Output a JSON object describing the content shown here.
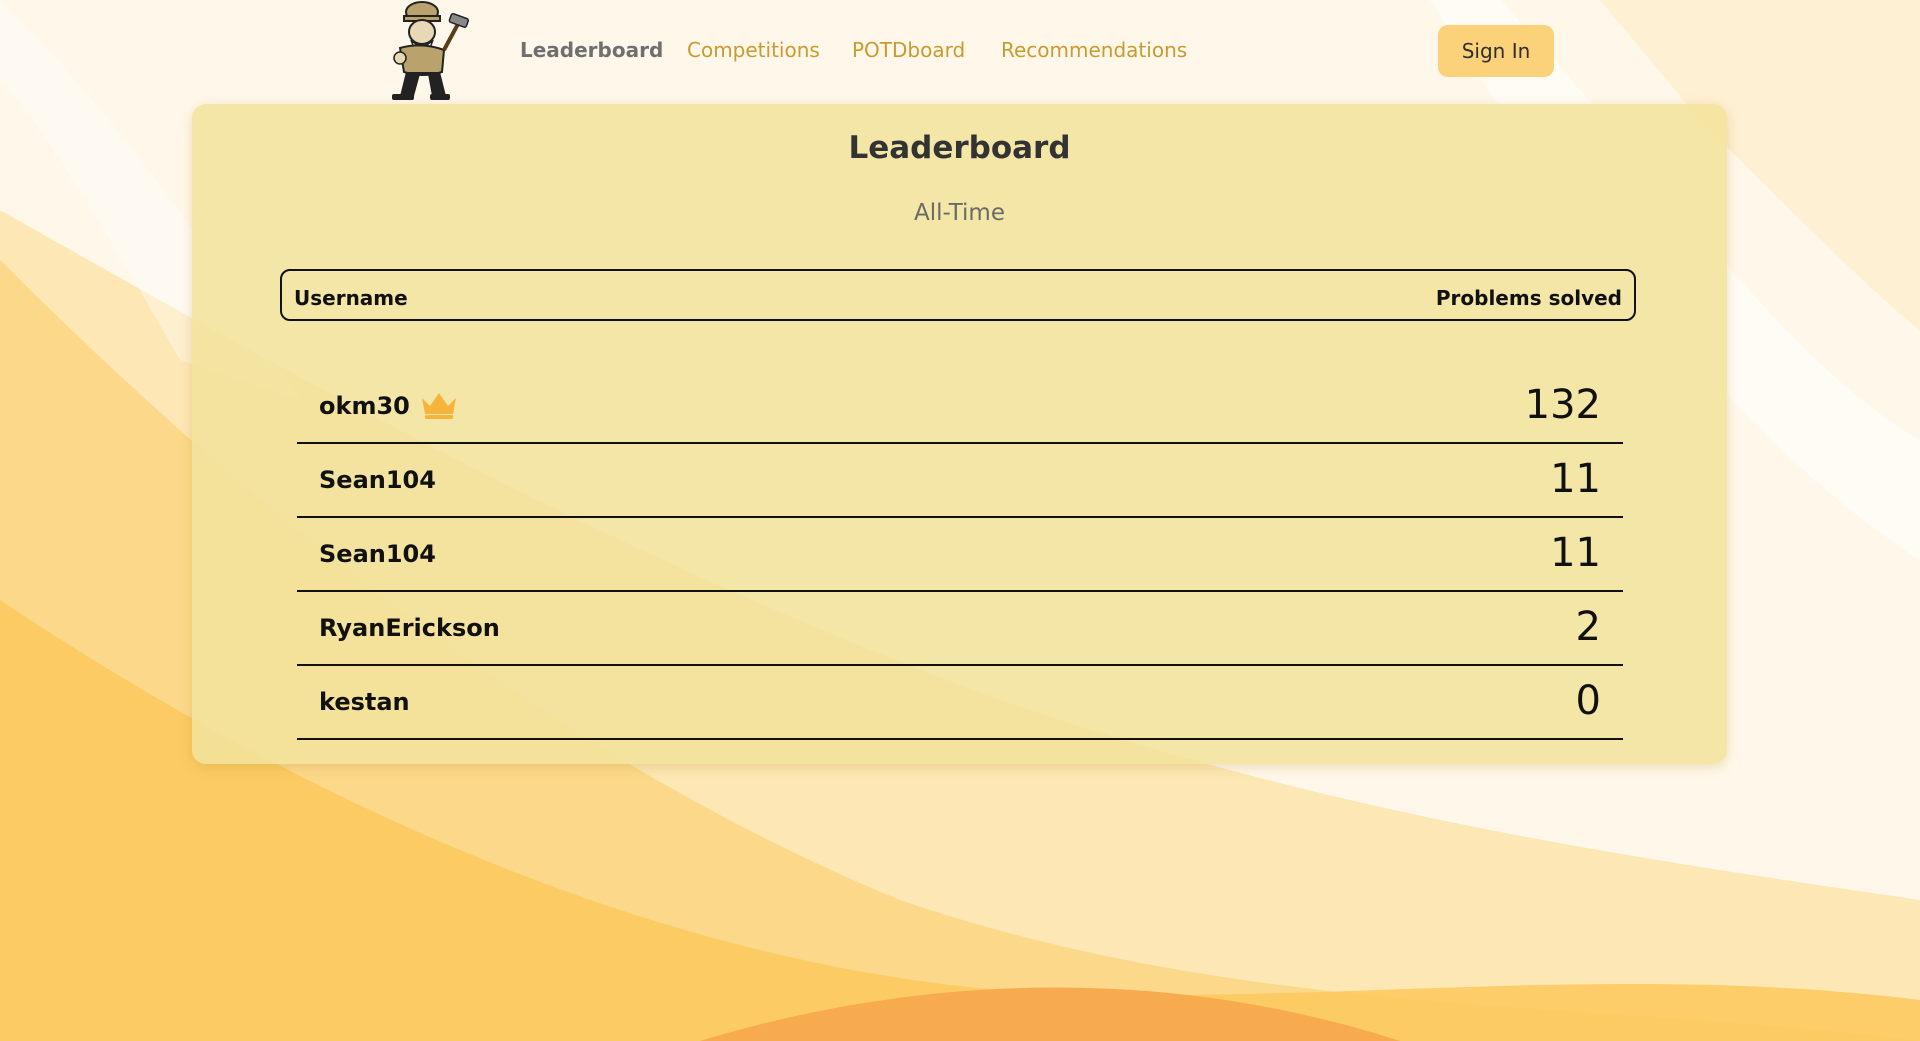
{
  "nav": {
    "logo_icon": "mascot-logo-icon",
    "links": [
      {
        "label": "Leaderboard",
        "active": true
      },
      {
        "label": "Competitions",
        "active": false
      },
      {
        "label": "POTDboard",
        "active": false
      },
      {
        "label": "Recommendations",
        "active": false
      }
    ],
    "signin_label": "Sign In"
  },
  "leaderboard": {
    "title": "Leaderboard",
    "period": "All-Time",
    "columns": {
      "username": "Username",
      "solved": "Problems solved"
    },
    "rows": [
      {
        "username": "okm30",
        "solved": "132",
        "leader_icon": "crown-icon"
      },
      {
        "username": "Sean104",
        "solved": "11"
      },
      {
        "username": "Sean104",
        "solved": "11"
      },
      {
        "username": "RyanErickson",
        "solved": "2"
      },
      {
        "username": "kestan",
        "solved": "0"
      }
    ]
  },
  "colors": {
    "accent": "#c99a2e",
    "signin_bg": "#fbd27a",
    "card_bg": "#f2e29c",
    "crown": "#f6b43c",
    "background_warm": "#fbc85c"
  }
}
